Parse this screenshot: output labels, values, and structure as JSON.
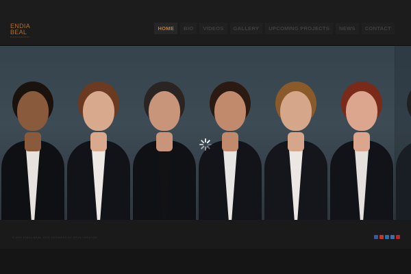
{
  "logo": {
    "line1": "ENDIA",
    "line2": "BEAL",
    "sub": "PHOTOGRAPHY"
  },
  "nav": {
    "items": [
      {
        "label": "HOME",
        "active": true
      },
      {
        "label": "BIO",
        "active": false
      },
      {
        "label": "VIDEOS",
        "active": false
      },
      {
        "label": "GALLERY",
        "active": false
      },
      {
        "label": "UPCOMING PROJECTS",
        "active": false
      },
      {
        "label": "NEWS",
        "active": false
      },
      {
        "label": "CONTACT",
        "active": false
      }
    ]
  },
  "gallery": {
    "portraits": [
      {
        "skin": "#8a5a3c",
        "hair": "#1a120d",
        "shirt": "#e6e3de",
        "jacket": "#0f1014"
      },
      {
        "skin": "#d9a98d",
        "hair": "#6b3a20",
        "shirt": "#ece9e4",
        "jacket": "#121318"
      },
      {
        "skin": "#c8957a",
        "hair": "#2a2522",
        "shirt": "#121214",
        "jacket": "#101114"
      },
      {
        "skin": "#c18a6c",
        "hair": "#2a1a12",
        "shirt": "#e8e6e2",
        "jacket": "#121419"
      },
      {
        "skin": "#d5a689",
        "hair": "#8a5a2a",
        "shirt": "#ebe8e3",
        "jacket": "#15161b"
      },
      {
        "skin": "#dba58e",
        "hair": "#7a2a18",
        "shirt": "#e4e1dc",
        "jacket": "#121318"
      },
      {
        "skin": "#7c5a48",
        "hair": "#1e1410",
        "shirt": "#e0ddd8",
        "jacket": "#0f1014"
      }
    ]
  },
  "loading": {
    "icon": "loading-spinner-icon",
    "color": "#ffffff"
  },
  "footer": {
    "copyright": "© 2011 ENDIA BEAL. SITE DESIGNED BY SPUN CREATIVE",
    "social": [
      {
        "icon": "facebook-icon",
        "color": "#3b5998"
      },
      {
        "icon": "google-plus-icon",
        "color": "#c0392b"
      },
      {
        "icon": "linkedin-icon",
        "color": "#2b6fa8"
      },
      {
        "icon": "flickr-icon",
        "color": "#3f6ea6"
      },
      {
        "icon": "youtube-icon",
        "color": "#b12a2a"
      }
    ]
  },
  "colors": {
    "accent": "#c97a2c",
    "background": "#151515"
  }
}
